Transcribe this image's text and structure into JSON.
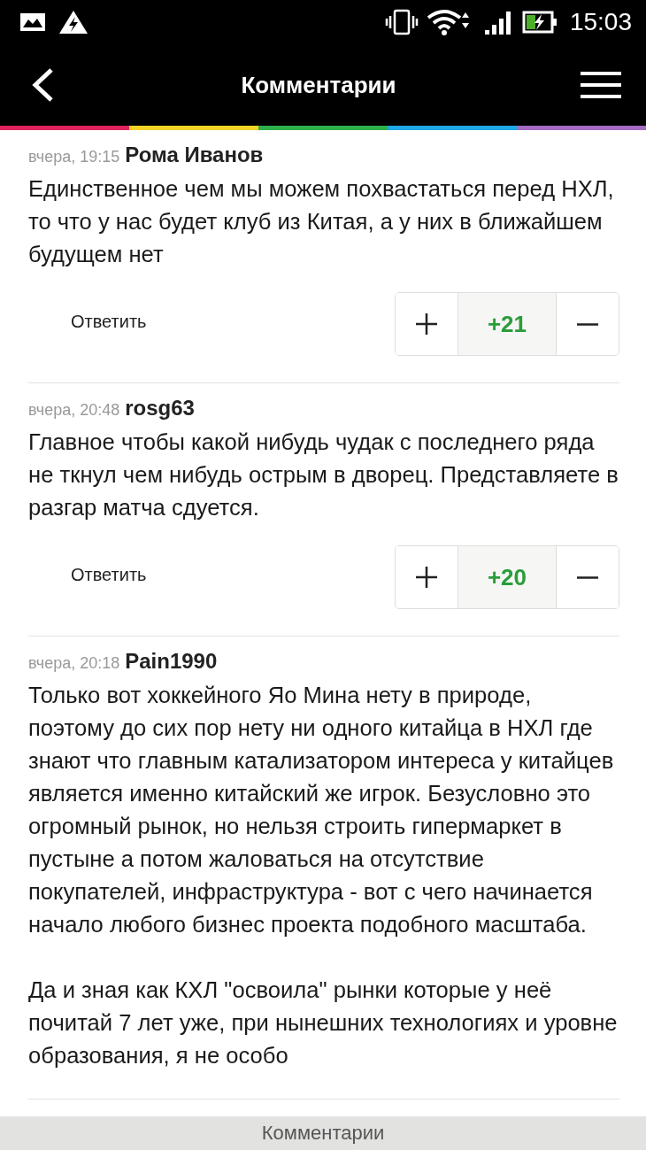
{
  "status_bar": {
    "time": "15:03"
  },
  "header": {
    "title": "Комментарии"
  },
  "comments": [
    {
      "time": "вчера, 19:15",
      "author": "Рома Иванов",
      "paragraphs": [
        "Единственное чем мы можем похвастаться перед НХЛ, то что у нас будет клуб из Китая, а у них в ближайшем будущем нет"
      ],
      "reply": "Ответить",
      "score": "+21"
    },
    {
      "time": "вчера, 20:48",
      "author": "rosg63",
      "paragraphs": [
        "Главное чтобы какой нибудь чудак с последнего ряда не ткнул чем нибудь острым в дворец. Представляете в разгар матча сдуется."
      ],
      "reply": "Ответить",
      "score": "+20"
    },
    {
      "time": "вчера, 20:18",
      "author": "Pain1990",
      "paragraphs": [
        "Только вот хоккейного Яо Мина нету в природе, поэтому до сих пор нету ни одного китайца в НХЛ где знают что главным катализатором интереса у китайцев является именно китайский же игрок. Безусловно это огромный рынок, но нельзя строить гипермаркет в пустыне а потом жаловаться на отсутствие покупателей, инфраструктура - вот с чего начинается начало любого бизнес проекта подобного масштаба.",
        "Да и зная как КХЛ \"освоила\" рынки которые у неё почитай 7 лет уже, при нынешних технологиях и уровне образования, я не особо"
      ]
    }
  ],
  "bottom_bar": {
    "label": "Комментарии"
  }
}
